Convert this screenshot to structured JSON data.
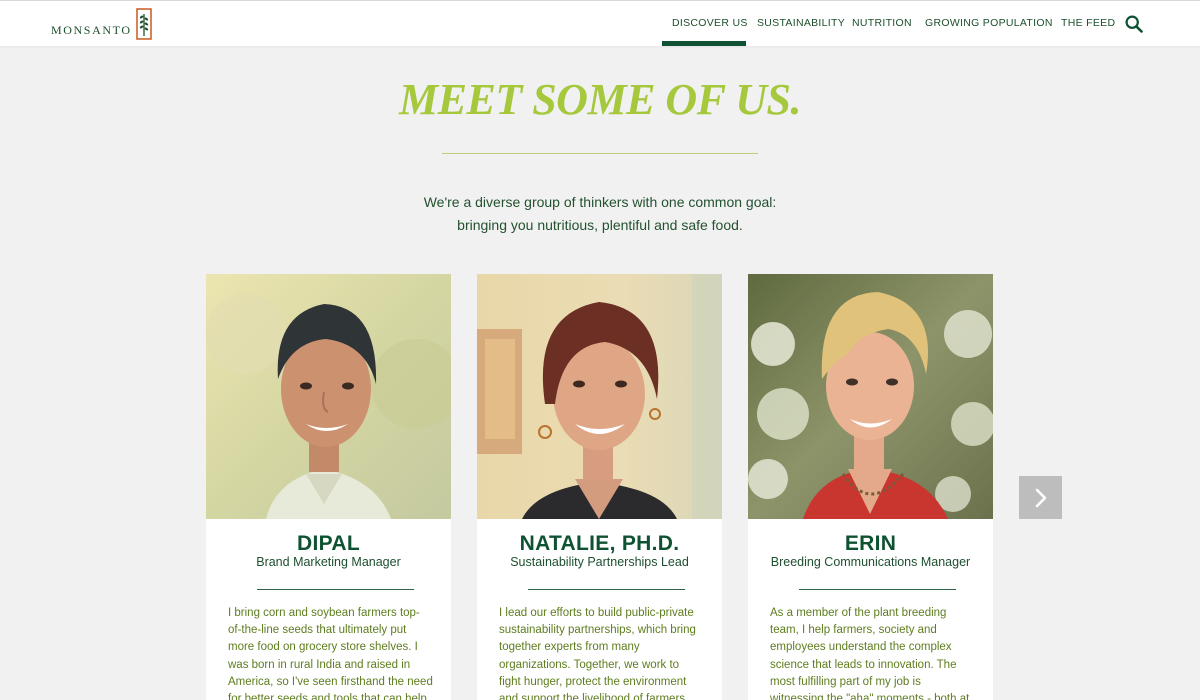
{
  "brand": {
    "name": "MONSANTO"
  },
  "nav": {
    "items": [
      {
        "label": "DISCOVER US",
        "active": true
      },
      {
        "label": "SUSTAINABILITY",
        "active": false
      },
      {
        "label": "NUTRITION",
        "active": false
      },
      {
        "label": "GROWING POPULATION",
        "active": false
      },
      {
        "label": "THE FEED",
        "active": false
      }
    ],
    "search_icon": "search-icon"
  },
  "hero": {
    "title": "MEET SOME OF US.",
    "intro_line1": "We're a diverse group of thinkers with one common goal:",
    "intro_line2": "bringing you nutritious, plentiful and safe food."
  },
  "people": [
    {
      "name": "DIPAL",
      "role": "Brand Marketing Manager",
      "bio_lines": [
        "I bring corn and soybean farmers top-",
        "of-the-line seeds that ultimately put",
        "more food on grocery store shelves. I",
        "was born in rural India and raised in",
        "America, so I've seen firsthand the need",
        "for better seeds and tools that can help"
      ]
    },
    {
      "name": "NATALIE, PH.D.",
      "role": "Sustainability Partnerships Lead",
      "bio_lines": [
        "I lead our efforts to build public-private",
        "sustainability partnerships, which bring",
        "together experts from many",
        "organizations. Together, we work to",
        "fight hunger, protect the environment",
        "and support the livelihood of farmers"
      ]
    },
    {
      "name": "ERIN",
      "role": "Breeding Communications Manager",
      "bio_lines": [
        "As a member of the plant breeding",
        "team, I help farmers, society and",
        "employees understand the complex",
        "science that leads to innovation. The",
        "most fulfilling part of my job is",
        "witnessing the \"aha\" moments - both at"
      ]
    }
  ],
  "carousel": {
    "next_icon": "chevron-right-icon"
  },
  "colors": {
    "brand_green": "#0e5233",
    "accent_lime": "#a5c83c",
    "bio_text": "#5e7d1e",
    "background": "#f1f1f1"
  }
}
